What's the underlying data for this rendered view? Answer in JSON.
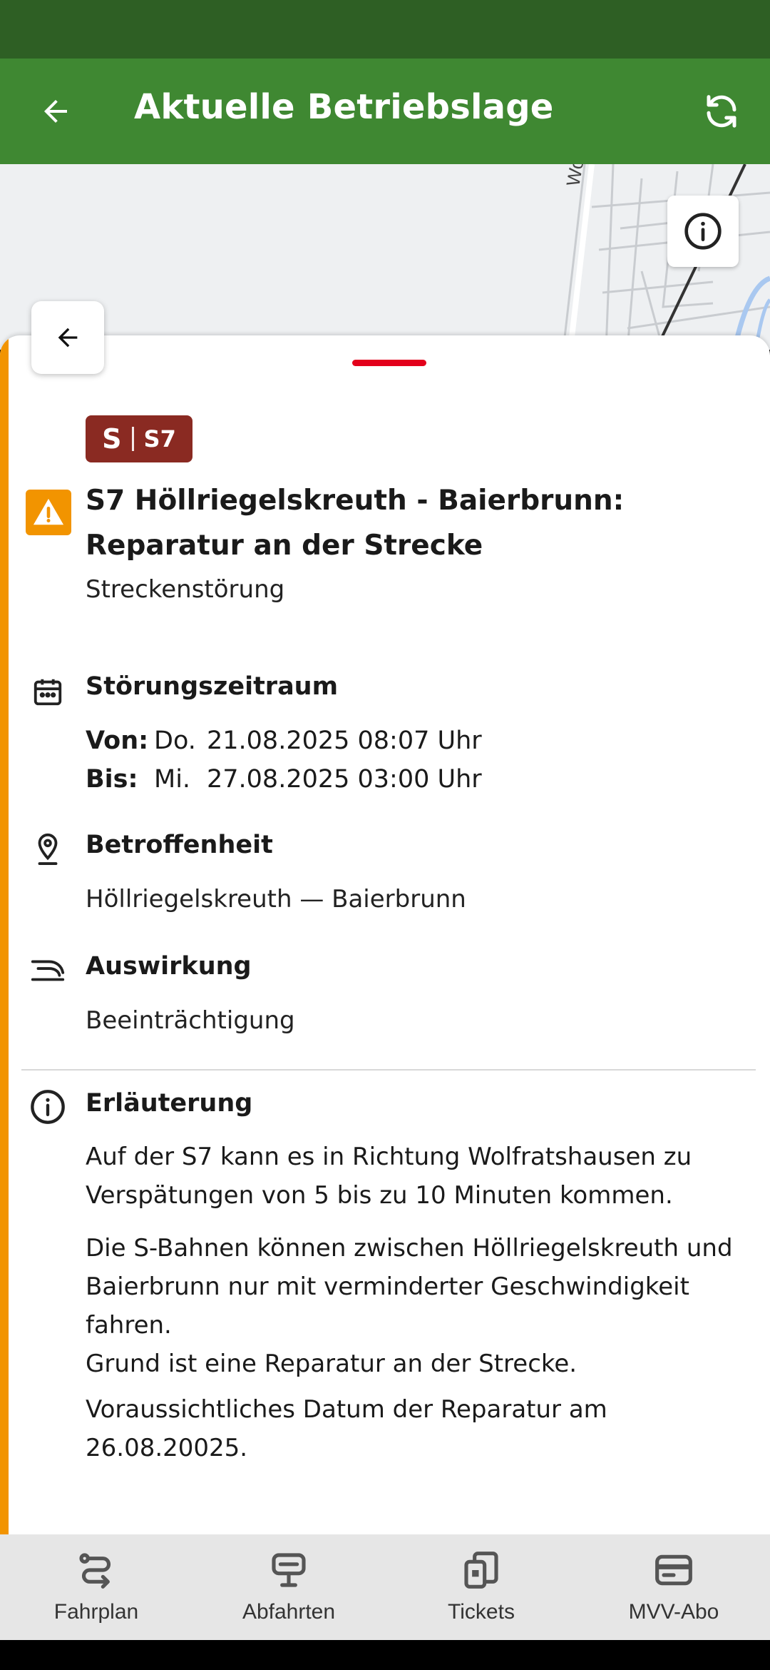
{
  "app_bar": {
    "title": "Aktuelle Betriebslage",
    "back_icon": "arrow-left-icon",
    "refresh_icon": "refresh-icon",
    "background": "#3f8832"
  },
  "map": {
    "street_label": "Wo",
    "info_icon": "info-icon"
  },
  "sheet": {
    "accent_color": "#f29400",
    "handle_color": "#e3001b",
    "line_badge": {
      "mode": "S",
      "line": "S7",
      "color": "#8a2a22"
    },
    "headline": "S7 Höllriegelskreuth - Baierbrunn: Reparatur an der Strecke",
    "subtitle": "Streckenstörung",
    "period": {
      "title": "Störungszeitraum",
      "from_label": "Von:",
      "from_day": "Do.",
      "from_value": "21.08.2025 08:07 Uhr",
      "to_label": "Bis:",
      "to_day": "Mi.",
      "to_value": "27.08.2025 03:00 Uhr"
    },
    "affected": {
      "title": "Betroffenheit",
      "value": "Höllriegelskreuth — Baierbrunn"
    },
    "impact": {
      "title": "Auswirkung",
      "value": "Beeinträchtigung"
    },
    "explanation": {
      "title": "Erläuterung",
      "paragraphs": [
        "Auf der S7 kann es in Richtung Wolfratshausen zu Verspätungen von 5 bis zu 10 Minuten kommen.",
        "Die S-Bahnen können zwischen Höllriegelskreuth und Baierbrunn nur mit verminderter Geschwindigkeit fahren.",
        "Grund ist eine Reparatur an der Strecke.",
        "Voraussichtliches Datum der Reparatur am 26.08.20025."
      ]
    }
  },
  "bottom_nav": [
    {
      "label": "Fahrplan",
      "icon": "route-icon"
    },
    {
      "label": "Abfahrten",
      "icon": "departure-board-icon"
    },
    {
      "label": "Tickets",
      "icon": "ticket-phone-icon"
    },
    {
      "label": "MVV-Abo",
      "icon": "card-icon"
    }
  ]
}
